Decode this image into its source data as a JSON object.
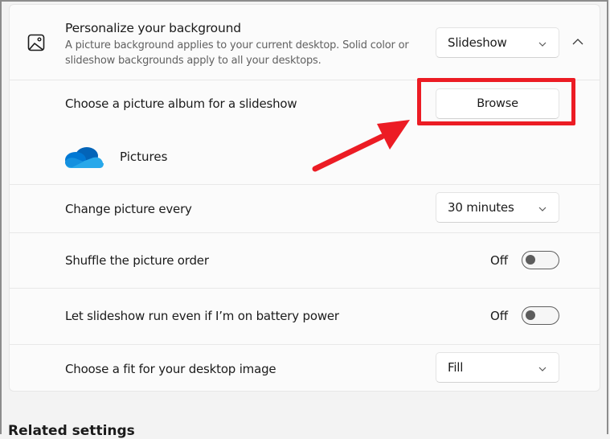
{
  "background_section": {
    "icon": "picture-icon",
    "title": "Personalize your background",
    "description": "A picture background applies to your current desktop. Solid color or slideshow backgrounds apply to all your desktops.",
    "type_select": {
      "value": "Slideshow",
      "icon": "chevron-down-icon"
    },
    "collapse_icon": "chevron-up-icon"
  },
  "album": {
    "label": "Choose a picture album for a slideshow",
    "browse_label": "Browse",
    "folder": {
      "icon": "onedrive-cloud-icon",
      "name": "Pictures"
    }
  },
  "interval": {
    "label": "Change picture every",
    "value": "30 minutes"
  },
  "shuffle": {
    "label": "Shuffle the picture order",
    "state": "Off",
    "on": false
  },
  "battery": {
    "label": "Let slideshow run even if I’m on battery power",
    "state": "Off",
    "on": false
  },
  "fit": {
    "label": "Choose a fit for your desktop image",
    "value": "Fill"
  },
  "related_settings": {
    "heading": "Related settings"
  },
  "annotation": {
    "color": "#ec1c24"
  },
  "colors": {
    "onedrive_dark": "#0364b8",
    "onedrive_mid": "#0078d4",
    "onedrive_light": "#28a8ea"
  }
}
